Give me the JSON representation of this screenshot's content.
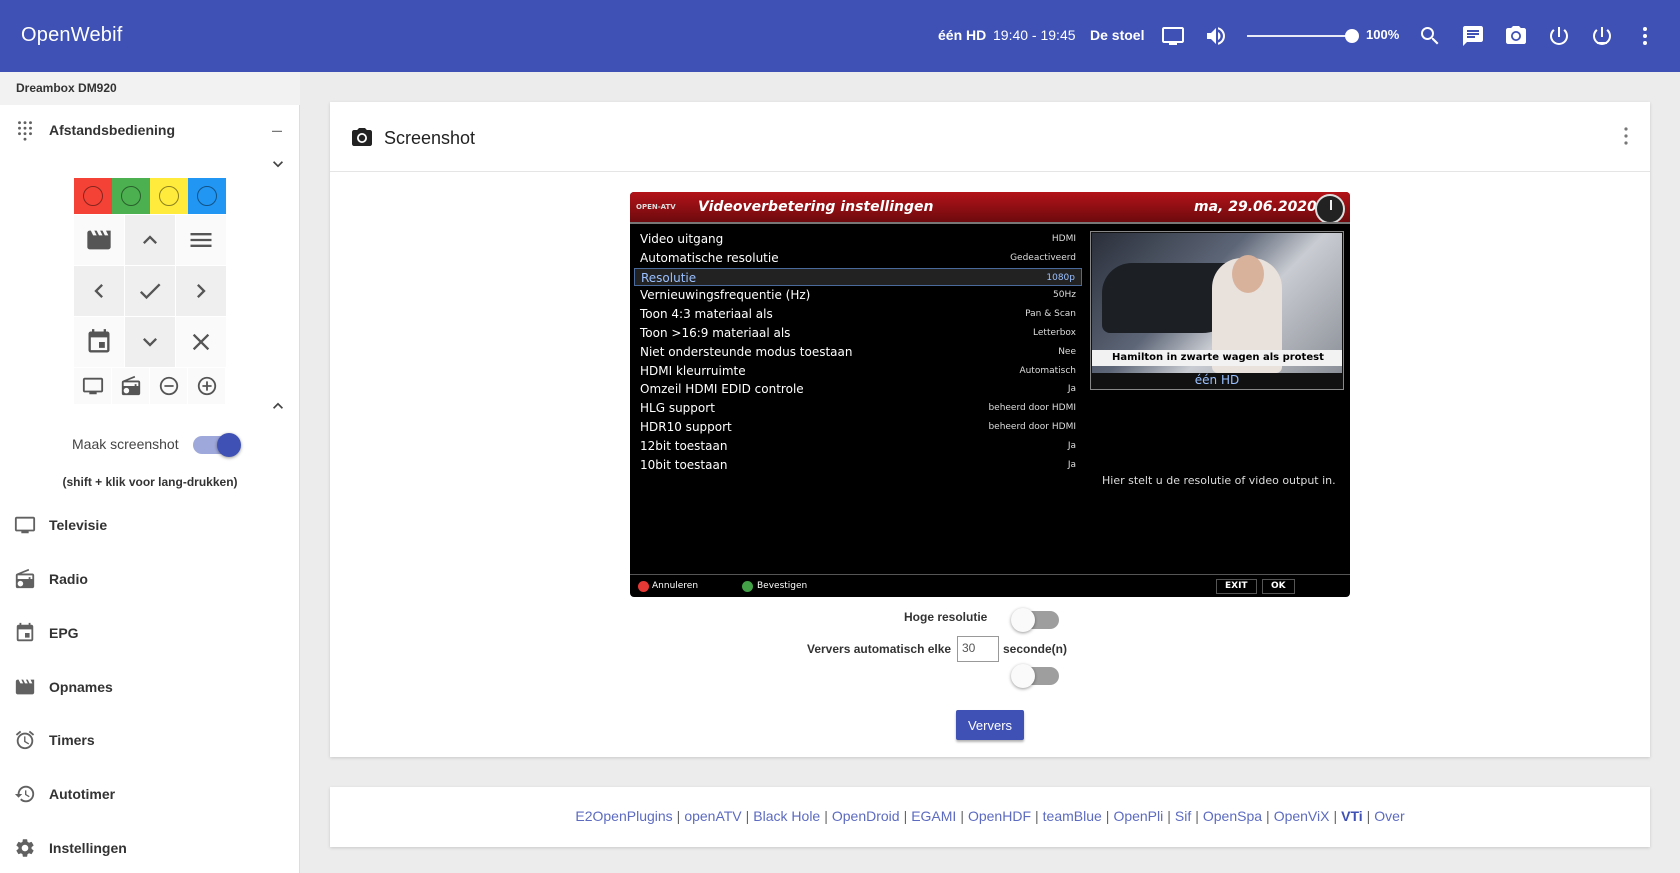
{
  "header": {
    "brand": "OpenWebif",
    "channel": "één HD",
    "time": "19:40 - 19:45",
    "program": "De stoel",
    "volume_label": "100%",
    "volume_level": 1.0,
    "icons": [
      "tv-icon",
      "volume-icon",
      "search-icon",
      "message-icon",
      "camera-icon",
      "power-icon",
      "standby-icon",
      "more-vert-icon"
    ]
  },
  "sidebar": {
    "device": "Dreambox DM920",
    "remote_label": "Afstandsbediening",
    "collapse_symbol": "–",
    "color_buttons": [
      {
        "name": "red",
        "color": "#f44336"
      },
      {
        "name": "green",
        "color": "#4caf50"
      },
      {
        "name": "yellow",
        "color": "#ffeb3b"
      },
      {
        "name": "blue",
        "color": "#2196f3"
      }
    ],
    "screenshot_toggle_label": "Maak screenshot",
    "screenshot_toggle_on": true,
    "longpress_hint": "(shift + klik voor lang-drukken)",
    "nav": [
      {
        "label": "Televisie",
        "icon": "tv-icon"
      },
      {
        "label": "Radio",
        "icon": "radio-icon"
      },
      {
        "label": "EPG",
        "icon": "calendar-icon"
      },
      {
        "label": "Opnames",
        "icon": "movie-icon"
      },
      {
        "label": "Timers",
        "icon": "alarm-icon"
      },
      {
        "label": "Autotimer",
        "icon": "history-icon"
      },
      {
        "label": "Instellingen",
        "icon": "gear-icon"
      }
    ]
  },
  "main": {
    "title": "Screenshot",
    "tv": {
      "logo": "OPEN-ATV",
      "title": "Videoverbetering instellingen",
      "date": "ma, 29.06.2020",
      "settings": [
        {
          "name": "Video uitgang",
          "value": "HDMI"
        },
        {
          "name": "Automatische resolutie",
          "value": "Gedeactiveerd"
        },
        {
          "name": "Resolutie",
          "value": "1080p"
        },
        {
          "name": "Vernieuwingsfrequentie (Hz)",
          "value": "50Hz"
        },
        {
          "name": "Toon 4:3 materiaal als",
          "value": "Pan & Scan"
        },
        {
          "name": "Toon >16:9 materiaal als",
          "value": "Letterbox"
        },
        {
          "name": "Niet ondersteunde modus toestaan",
          "value": "Nee"
        },
        {
          "name": "HDMI kleurruimte",
          "value": "Automatisch"
        },
        {
          "name": "Omzeil HDMI EDID controle",
          "value": "Ja"
        },
        {
          "name": "HLG support",
          "value": "beheerd door HDMI"
        },
        {
          "name": "HDR10 support",
          "value": "beheerd door HDMI"
        },
        {
          "name": "12bit toestaan",
          "value": "Ja"
        },
        {
          "name": "10bit toestaan",
          "value": "Ja"
        }
      ],
      "selected_index": 2,
      "pip_caption": "Hamilton in zwarte wagen als protest",
      "pip_channel": "één HD",
      "help": "Hier stelt u de resolutie of video output in.",
      "footer": {
        "red": "Annuleren",
        "green": "Bevestigen",
        "exit": "EXIT",
        "ok": "OK"
      }
    },
    "high_res_label": "Hoge resolutie",
    "high_res_on": false,
    "refresh_label": "Ververs automatisch elke",
    "refresh_value": "30",
    "refresh_unit": "seconde(n)",
    "auto_refresh_on": false,
    "refresh_button": "Ververs"
  },
  "footer": {
    "links": [
      "E2OpenPlugins",
      "openATV",
      "Black Hole",
      "OpenDroid",
      "EGAMI",
      "OpenHDF",
      "teamBlue",
      "OpenPli",
      "Sif",
      "OpenSpa",
      "OpenViX",
      "VTi",
      "Over"
    ],
    "bold_link": "VTi"
  }
}
